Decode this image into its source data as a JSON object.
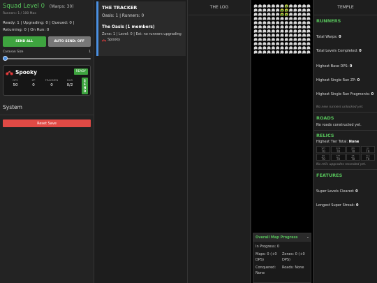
{
  "squad": {
    "title": "Squad Level 0",
    "warps": "(Warps: 30)",
    "runners_max": "Runners: 1 / 100 Max",
    "status_line1": "Ready: 1 | Upgrading: 0 | Queued: 0 |",
    "status_line2": "Returning: 0 | On Run: 0",
    "send_all_label": "SEND ALL",
    "auto_send_label": "AUTO SEND: OFF",
    "caravan_label": "Caravan Size",
    "caravan_value": "1",
    "caravan_fraction": 0.0
  },
  "runner": {
    "name": "Spooky",
    "status": "READY",
    "columns": [
      {
        "h": "DPS",
        "v": "50"
      },
      {
        "h": "ZP",
        "v": "0"
      },
      {
        "h": "FRAGMEN",
        "v": "0"
      },
      {
        "h": "DUR",
        "v": "0/2"
      }
    ],
    "send_label": "SEND"
  },
  "system": {
    "title": "System",
    "reset_label": "Reset Save"
  },
  "tracker": {
    "title": "THE TRACKER",
    "oasis_line": "Oasis: 1 | Runners: 0",
    "members": "The Oasis (1 members)",
    "zone": "Zone: 1 | Level: 0 | Est: no runners upgrading",
    "runner_name": "Spooky"
  },
  "log": {
    "title": "THE LOG"
  },
  "map_progress": {
    "title": "Overall Map Progress",
    "collapse": "-",
    "in_progress": "In Progress: 0",
    "maps": "Maps: 0 (+0 DPS)",
    "zones": "Zones: 0 (+0 DPS)",
    "conquered": "Conquered: None",
    "roads": "Roads: None"
  },
  "temple": {
    "title": "TEMPLE",
    "runners_title": "RUNNERS",
    "total_warps_label": "Total Warps:",
    "total_warps": "0",
    "total_levels_label": "Total Levels Completed:",
    "total_levels": "0",
    "highest_dps_label": "Highest Base DPS:",
    "highest_dps": "0",
    "highest_zp_label": "Highest Single Run ZP:",
    "highest_zp": "0",
    "highest_frag_label": "Highest Single Run Fragments:",
    "highest_frag": "0",
    "no_runners_note": "No new runners unlocked yet.",
    "roads_title": "ROADS",
    "roads_text": "No roads constructed yet.",
    "relics_title": "RELICS",
    "tier_total_label": "Highest Tier Total:",
    "tier_total": "None",
    "tiers": [
      {
        "l": "WH",
        "v": "T0"
      },
      {
        "l": "SCS",
        "v": "T0"
      },
      {
        "l": "RN",
        "v": "T0"
      },
      {
        "l": "IO",
        "v": "T0"
      },
      {
        "l": "DR",
        "v": "T0"
      },
      {
        "l": "STT",
        "v": "T0"
      },
      {
        "l": "SB",
        "v": "T0"
      },
      {
        "l": "VLS",
        "v": "T0"
      }
    ],
    "no_relics_note": "No relic upgrades recorded yet.",
    "features_title": "FEATURES",
    "super_levels_label": "Super Levels Cleared:",
    "super_levels": "0",
    "longest_streak_label": "Longest Super Streak:",
    "longest_streak": "0"
  },
  "colors": {
    "accent_green": "#56c15a",
    "button_green": "#3ea43f",
    "reset_red": "#e04a45",
    "tracker_blue": "#4a90e2"
  }
}
